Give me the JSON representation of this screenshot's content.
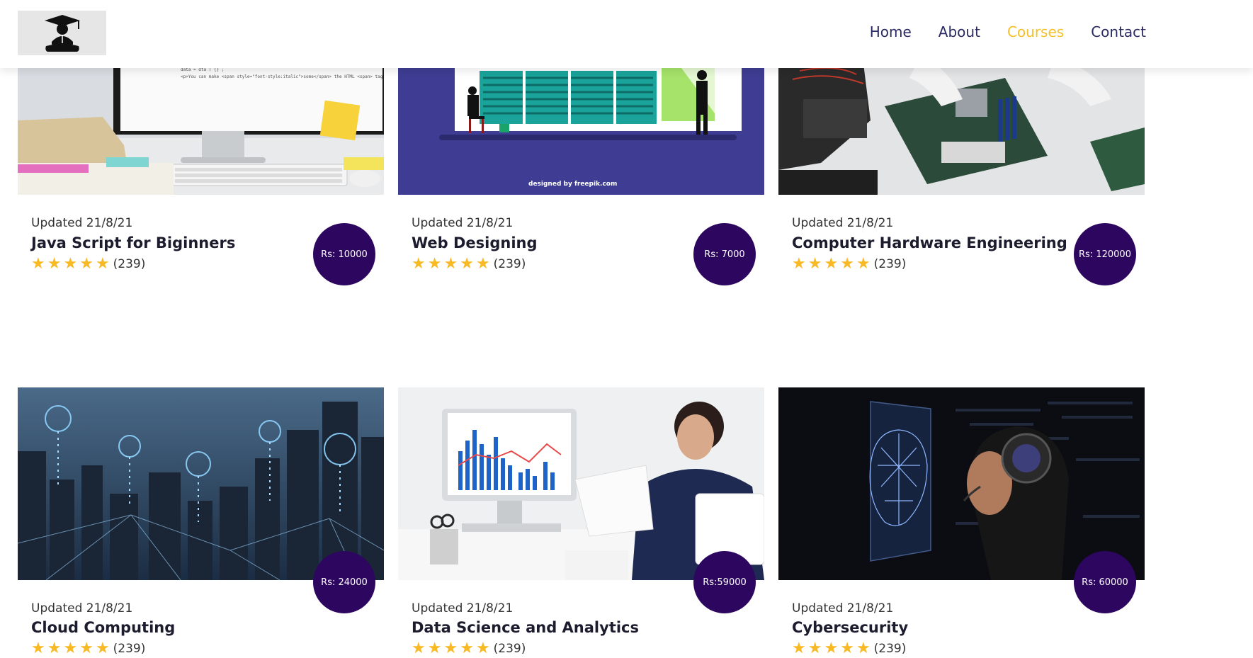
{
  "nav": {
    "links": [
      {
        "label": "Home",
        "active": false
      },
      {
        "label": "About",
        "active": false
      },
      {
        "label": "Courses",
        "active": true
      },
      {
        "label": "Contact",
        "active": false
      }
    ],
    "accent_color": "#f4c02b",
    "text_color": "#2b2b63"
  },
  "courses": [
    {
      "updated": "Updated 21/8/21",
      "title": "Java Script for Biginners",
      "rating_count": "(239)",
      "price": "Rs: 10000",
      "stars": 5,
      "image": "desktop-computer-photo"
    },
    {
      "updated": "Updated 21/8/21",
      "title": "Web Designing",
      "rating_count": "(239)",
      "price": "Rs: 7000",
      "stars": 5,
      "image": "web-design-illustration",
      "image_credit": "designed by freepik.com"
    },
    {
      "updated": "Updated 21/8/21",
      "title": "Computer Hardware Engineering",
      "rating_count": "(239)",
      "price": "Rs: 120000",
      "stars": 5,
      "image": "motherboard-photo"
    },
    {
      "updated": "Updated 21/8/21",
      "title": "Cloud Computing",
      "rating_count": "(239)",
      "price": "Rs: 24000",
      "stars": 5,
      "image": "cloud-city-photo"
    },
    {
      "updated": "Updated 21/8/21",
      "title": "Data Science and Analytics",
      "rating_count": "(239)",
      "price": "Rs:59000",
      "stars": 5,
      "image": "data-analyst-photo"
    },
    {
      "updated": "Updated 21/8/21",
      "title": "Cybersecurity",
      "rating_count": "(239)",
      "price": "Rs: 60000",
      "stars": 5,
      "image": "cyber-face-scan-photo"
    }
  ],
  "colors": {
    "badge": "#2d0660",
    "star": "#f7b924"
  }
}
